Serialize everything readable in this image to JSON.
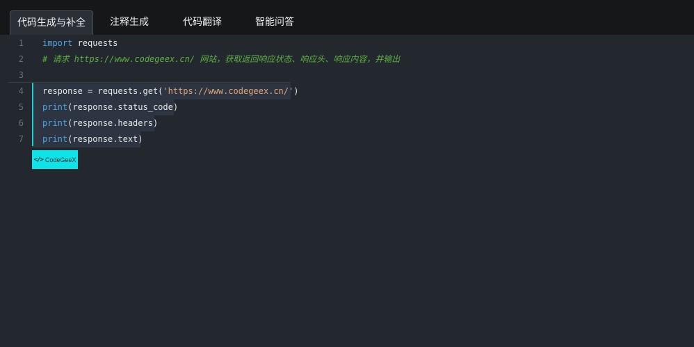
{
  "tabs": [
    {
      "label": "代码生成与补全",
      "active": true
    },
    {
      "label": "注释生成",
      "active": false
    },
    {
      "label": "代码翻译",
      "active": false
    },
    {
      "label": "智能问答",
      "active": false
    }
  ],
  "editor": {
    "lines": [
      {
        "number": "1",
        "tokens": [
          {
            "type": "kw",
            "text": "import"
          },
          {
            "type": "plain",
            "text": " requests"
          }
        ]
      },
      {
        "number": "2",
        "tokens": [
          {
            "type": "comment",
            "text": "# 请求 https://www.codegeex.cn/ 网站，获取返回响应状态、响应头、响应内容，并输出"
          }
        ]
      },
      {
        "number": "3",
        "tokens": []
      },
      {
        "number": "4",
        "tokens": [
          {
            "type": "plain",
            "text": "response = requests.get("
          },
          {
            "type": "str",
            "text": "'https://www.codegeex.cn/'"
          },
          {
            "type": "plain",
            "text": ")"
          }
        ]
      },
      {
        "number": "5",
        "tokens": [
          {
            "type": "kw",
            "text": "print"
          },
          {
            "type": "plain",
            "text": "(response.status_code)"
          }
        ]
      },
      {
        "number": "6",
        "tokens": [
          {
            "type": "kw",
            "text": "print"
          },
          {
            "type": "plain",
            "text": "(response.headers)"
          }
        ]
      },
      {
        "number": "7",
        "tokens": [
          {
            "type": "kw",
            "text": "print"
          },
          {
            "type": "plain",
            "text": "(response.text)"
          }
        ]
      }
    ]
  },
  "badge": {
    "icon": "</>",
    "label": "CodeGeeX"
  },
  "colors": {
    "accent": "#0ee4e8",
    "keyword": "#4fa3e0",
    "string": "#e2a476",
    "comment": "#5db043",
    "editor_bg": "#23272e",
    "tabbar_bg": "#161718"
  }
}
